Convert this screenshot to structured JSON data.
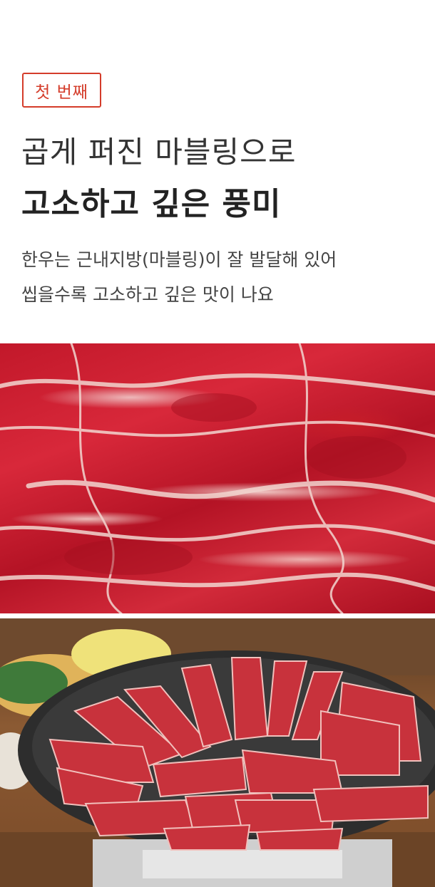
{
  "badge": {
    "label": "첫 번째"
  },
  "headline": {
    "line1": "곱게 퍼진 마블링으로",
    "line2": "고소하고 깊은 풍미"
  },
  "description": {
    "line1": "한우는 근내지방(마블링)이 잘 발달해 있어",
    "line2": "씹을수록 고소하고 깊은 맛이 나요"
  },
  "images": {
    "top": {
      "icon": "raw-marbled-beef-photo"
    },
    "bottom": {
      "icon": "grilled-beef-on-pan-photo"
    }
  },
  "colors": {
    "accent": "#d43c2a",
    "text_dark": "#222222",
    "text_body": "#444444"
  }
}
